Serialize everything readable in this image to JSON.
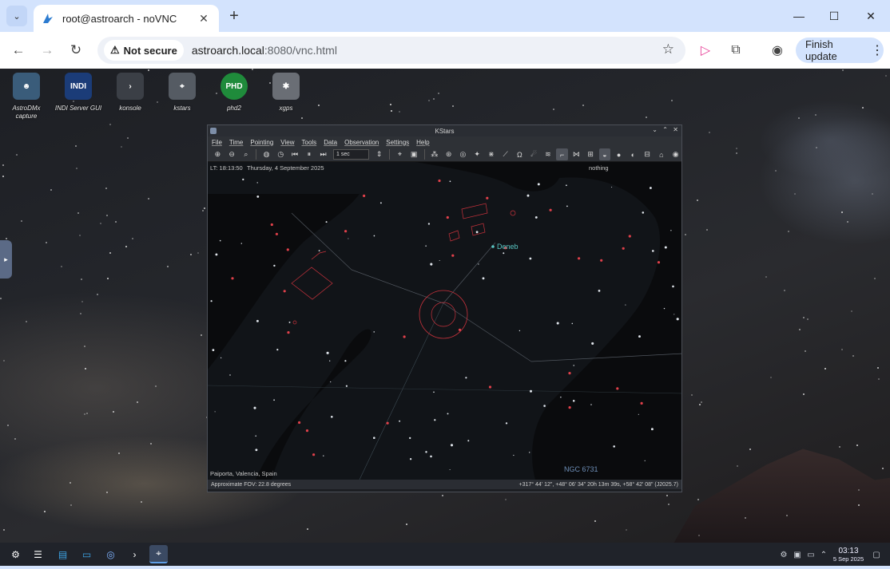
{
  "browser": {
    "tab_title": "root@astroarch - noVNC",
    "security_label": "Not secure",
    "url_host": "astroarch.local",
    "url_rest": ":8080/vnc.html",
    "finish_update_label": "Finish update"
  },
  "desktop": {
    "icons": [
      {
        "label": "AstroDMx capture",
        "icon": "astrodmx-icon",
        "color": "#3a5c7a"
      },
      {
        "label": "INDI Server GUI",
        "icon": "indi-icon",
        "color": "#1b3c78"
      },
      {
        "label": "konsole",
        "icon": "terminal-icon",
        "color": "#3b3f46"
      },
      {
        "label": "kstars",
        "icon": "telescope-icon",
        "color": "#555b63"
      },
      {
        "label": "phd2",
        "icon": "phd2-icon",
        "color": "#1f8b3b"
      },
      {
        "label": "xgps",
        "icon": "satellite-icon",
        "color": "#6a6e75"
      }
    ]
  },
  "kstars": {
    "window_title": "KStars",
    "menu": [
      "File",
      "Time",
      "Pointing",
      "View",
      "Tools",
      "Data",
      "Observation",
      "Settings",
      "Help"
    ],
    "time_step": "1 sec",
    "lt_time": "LT: 18:13:50",
    "date": "Thursday, 4 September 2025",
    "focus_object": "nothing",
    "location": "Paiporta, Valencia, Spain",
    "fov": "Approximate FOV: 22.8 degrees",
    "coords": "+317° 44' 12\", +48° 06' 34\"  20h 13m 39s, +58° 42' 08\" (J2025.7)",
    "label_deneb": "Deneb",
    "label_ngc": "NGC 6731"
  },
  "taskbar": {
    "time": "03:13",
    "date": "5 Sep 2025"
  },
  "colors": {
    "accent": "#d3e3fd",
    "deneb": "#59c6c3",
    "sky_markers": "#e0404a"
  }
}
